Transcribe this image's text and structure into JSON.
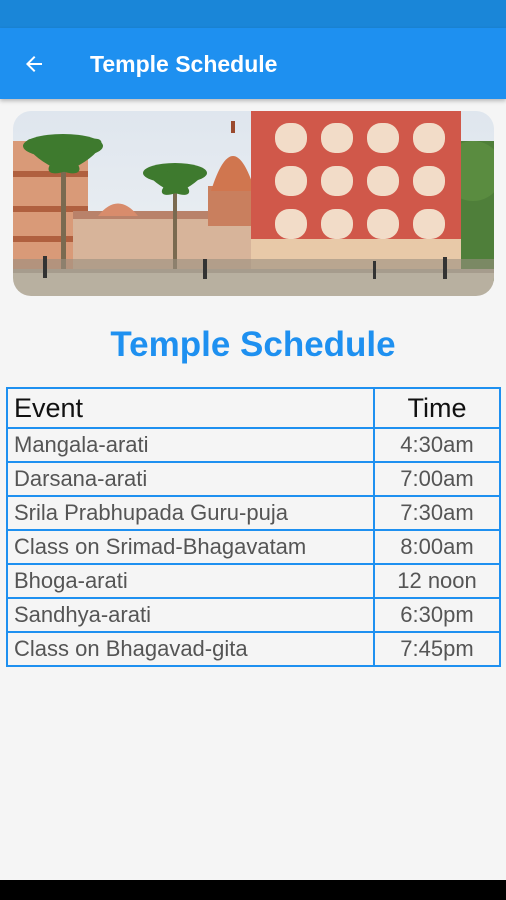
{
  "appbar": {
    "title": "Temple Schedule"
  },
  "page": {
    "heading": "Temple Schedule"
  },
  "table": {
    "headers": {
      "event": "Event",
      "time": "Time"
    },
    "rows": [
      {
        "event": "Mangala-arati",
        "time": "4:30am"
      },
      {
        "event": "Darsana-arati",
        "time": "7:00am"
      },
      {
        "event": "Srila Prabhupada Guru-puja",
        "time": "7:30am"
      },
      {
        "event": "Class on Srimad-Bhagavatam",
        "time": "8:00am"
      },
      {
        "event": "Bhoga-arati",
        "time": "12 noon"
      },
      {
        "event": "Sandhya-arati",
        "time": "6:30pm"
      },
      {
        "event": "Class on Bhagavad-gita",
        "time": "7:45pm"
      }
    ]
  },
  "colors": {
    "primary": "#1e90f0",
    "status_bar": "#1a86d8"
  },
  "icons": {
    "back": "arrow-left-icon"
  }
}
